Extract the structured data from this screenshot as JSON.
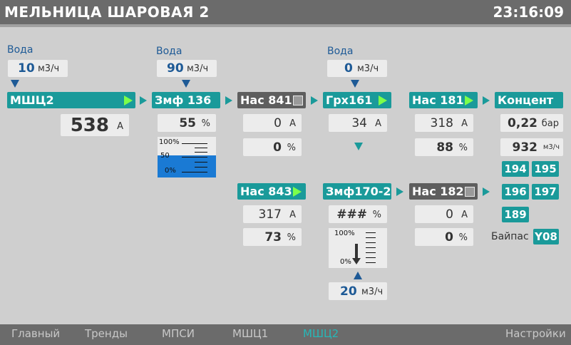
{
  "header": {
    "title": "МЕЛЬНИЦА ШАРОВАЯ 2",
    "time": "23:16:09"
  },
  "water": [
    {
      "label": "Вода",
      "value": "10",
      "unit": "м3/ч"
    },
    {
      "label": "Вода",
      "value": "90",
      "unit": "м3/ч"
    },
    {
      "label": "Вода",
      "value": "0",
      "unit": "м3/ч"
    }
  ],
  "devices": {
    "mshc2": {
      "name": "МШЦ2",
      "current_value": "538",
      "current_unit": "А"
    },
    "zmf136": {
      "name": "Змф 136",
      "level_value": "55",
      "level_unit": "%",
      "level": 0.55,
      "scale": {
        "top": "100%",
        "mid": "50",
        "bottom": "0%"
      }
    },
    "nas841": {
      "name": "Нас 841",
      "current_value": "0",
      "current_unit": "А",
      "percent_value": "0",
      "percent_unit": "%"
    },
    "grx161": {
      "name": "Грх161",
      "current_value": "34",
      "current_unit": "А"
    },
    "nas181": {
      "name": "Нас 181",
      "current_value": "318",
      "current_unit": "А",
      "percent_value": "88",
      "percent_unit": "%"
    },
    "koncent": {
      "name": "Концент",
      "pressure_value": "0,22",
      "pressure_unit": "бар",
      "flow_value": "932",
      "flow_unit": "м3/ч"
    },
    "nas843": {
      "name": "Нас 843",
      "current_value": "317",
      "current_unit": "А",
      "percent_value": "73",
      "percent_unit": "%"
    },
    "zmf170": {
      "name": "Змф170-2",
      "level_value": "###",
      "level_unit": "%",
      "scale": {
        "top": "100%",
        "bottom": "0%"
      },
      "flow_value": "20",
      "flow_unit": "м3/ч"
    },
    "nas182": {
      "name": "Нас 182",
      "current_value": "0",
      "current_unit": "А",
      "percent_value": "0",
      "percent_unit": "%"
    }
  },
  "tags": {
    "t194": "194",
    "t195": "195",
    "t196": "196",
    "t197": "197",
    "t189": "189",
    "bypass_label": "Байпас",
    "y08": "Y08"
  },
  "footer": {
    "items": [
      "Главный",
      "Тренды",
      "МПСИ",
      "МШЦ1",
      "МШЦ2",
      "Настройки"
    ],
    "active": "МШЦ2"
  },
  "colors": {
    "teal": "#1a9a9a",
    "dark_gray": "#5e5e5e",
    "blue": "#1e5a96",
    "run_green": "#7cff4a",
    "level_blue": "#1a7ad4"
  }
}
